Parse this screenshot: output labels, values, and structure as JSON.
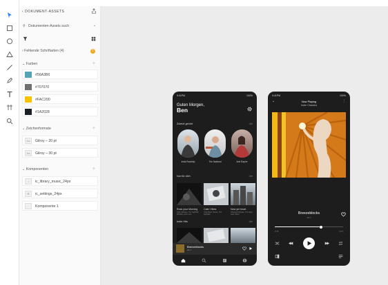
{
  "panel": {
    "title": "DOKUMENT-ASSETS",
    "search_label": "Dokumenten-Assets such",
    "missing_fonts": "Fehlende Schriftarten (4)",
    "colors_label": "Farben",
    "colors": [
      {
        "label": "#56A3B6",
        "hex": "#56A3B6"
      },
      {
        "label": "#707070",
        "hex": "#707070"
      },
      {
        "label": "#FAC200",
        "hex": "#FAC200"
      },
      {
        "label": "#1A2028",
        "hex": "#1A2028"
      }
    ],
    "char_styles_label": "Zeichenformate",
    "char_styles": [
      {
        "label": "Gilroy – 20 pt",
        "tile": "Aa"
      },
      {
        "label": "Gilroy – 30 pt",
        "tile": "Aa"
      }
    ],
    "components_label": "Komponenten",
    "components": [
      {
        "label": "ic_library_music_24px"
      },
      {
        "label": "ic_settings_24px"
      },
      {
        "label": "Komponente 1"
      }
    ]
  },
  "phone1": {
    "status_time": "9:41PM",
    "status_batt": "100%",
    "greeting": "Guten Morgen,",
    "name": "Ben",
    "recent_title": "Zuletzt gehört",
    "more": "Alle",
    "recent": [
      {
        "label": "Indie Roadtrip"
      },
      {
        "label": "The National"
      },
      {
        "label": "Arte Raphe"
      }
    ],
    "foryou_title": "Nur für dich",
    "foryou": [
      {
        "title": "Rock your Morning",
        "sub": "Indie Mixtape, The Nightfall, Whiskey and more"
      },
      {
        "title": "Calm Vibes",
        "sub": "Yoke Beat, Nicole, The Nightfall"
      },
      {
        "title": "Now yer heart",
        "sub": "Shepard Mixtape, The High Heel, Mixiz"
      }
    ],
    "indie_title": "Indie Hits",
    "mini_title": "Breezeblocks",
    "mini_artist": "alt-J"
  },
  "phone2": {
    "status_time": "9:41PM",
    "status_batt": "100%",
    "now_playing": "Now Playing",
    "playlist": "Indie Classics",
    "song": "Breezeblocks",
    "artist": "alt-J",
    "elapsed": "3:15",
    "total": "3:47",
    "progress": 0.68
  }
}
